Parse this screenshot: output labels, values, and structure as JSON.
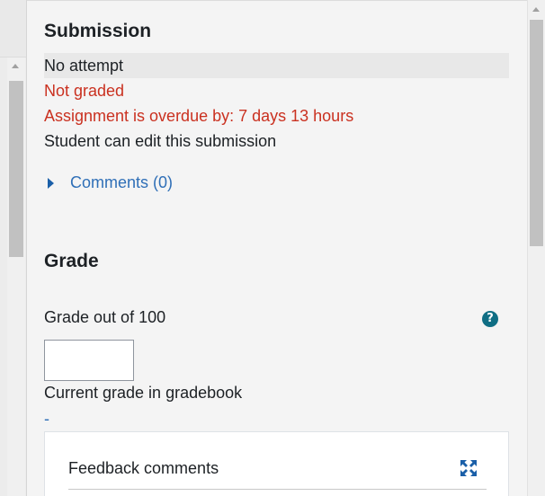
{
  "submission": {
    "title": "Submission",
    "attempt_status": "No attempt",
    "grading_status": "Not graded",
    "overdue_text": "Assignment is overdue by: 7 days 13 hours",
    "edit_status": "Student can edit this submission",
    "comments_link": "Comments (0)"
  },
  "grade": {
    "title": "Grade",
    "grade_label": "Grade out of 100",
    "help_icon": "?",
    "grade_value": "",
    "current_grade_label": "Current grade in gradebook",
    "current_grade_value": "-"
  },
  "feedback": {
    "label": "Feedback comments",
    "expand_icon": "fullscreen-expand-icon"
  },
  "colors": {
    "error_red": "#ca3120",
    "link_blue": "#2f6fb7",
    "help_teal": "#0f6e84"
  }
}
